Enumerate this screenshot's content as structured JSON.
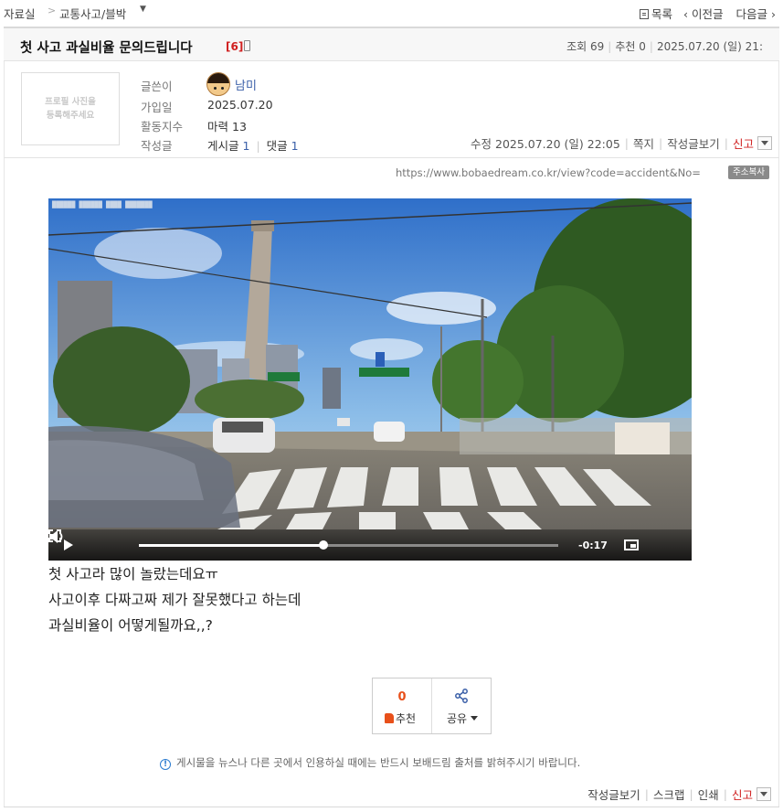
{
  "nav": {
    "root": "자료실",
    "sep": ">",
    "category": "교통사고/블박",
    "list": "목록",
    "prev": "‹ 이전글",
    "next": "다음글 ›"
  },
  "post": {
    "title": "첫 사고 과실비율 문의드립니다",
    "comment_badge": "[6]",
    "meta": {
      "views_label": "조회",
      "views": "69",
      "rec_label": "추천",
      "rec": "0",
      "date": "2025.07.20 (일) 21:"
    }
  },
  "profile_placeholder": [
    "프로필 사진을",
    "등록해주세요"
  ],
  "author": {
    "name_label": "글쓴이",
    "name": "남미",
    "join_label": "가입일",
    "join": "2025.07.20",
    "activity_label": "활동지수",
    "activity_kind": "마력",
    "activity": "13",
    "written_label": "작성글",
    "posts_label": "게시글",
    "posts": "1",
    "comments_label": "댓글",
    "comments": "1"
  },
  "edit_line": {
    "edited": "수정 2025.07.20 (일) 22:05",
    "note": "쪽지",
    "view_posts": "작성글보기",
    "report": "신고"
  },
  "url": {
    "text": "https://www.bobaedream.co.kr/view?code=accident&No=",
    "copy": "주소복사"
  },
  "video": {
    "time_left": "-0:17",
    "progress": 0.44,
    "playing": false
  },
  "body_lines": [
    "첫 사고라 많이 놀랐는데요ㅠ",
    "사고이후 다짜고짜 제가 잘못했다고 하는데",
    "과실비율이 어떻게될까요,,?"
  ],
  "actions": {
    "rec_count": "0",
    "rec_label": "추천",
    "share_label": "공유"
  },
  "notice": "게시물을 뉴스나 다른 곳에서 인용하실 때에는 반드시 보배드림 출처를 밝혀주시기 바랍니다.",
  "bottom": {
    "view_posts": "작성글보기",
    "scrap": "스크랩",
    "print": "인쇄",
    "report": "신고"
  },
  "colors": {
    "accent_red": "#d02020",
    "link_blue": "#3a5fa8",
    "rec_orange": "#e8501a"
  }
}
